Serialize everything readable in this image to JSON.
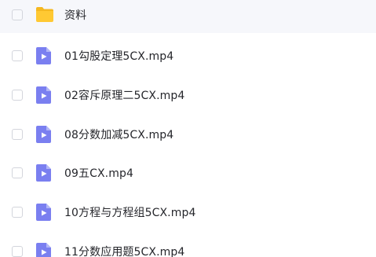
{
  "files": [
    {
      "name": "资料",
      "type": "folder",
      "icon": "folder-icon"
    },
    {
      "name": "01勾股定理5CX.mp4",
      "type": "video",
      "icon": "video-file-icon"
    },
    {
      "name": "02容斥原理二5CX.mp4",
      "type": "video",
      "icon": "video-file-icon"
    },
    {
      "name": "08分数加减5CX.mp4",
      "type": "video",
      "icon": "video-file-icon"
    },
    {
      "name": "09五CX.mp4",
      "type": "video",
      "icon": "video-file-icon"
    },
    {
      "name": "10方程与方程组5CX.mp4",
      "type": "video",
      "icon": "video-file-icon"
    },
    {
      "name": "11分数应用题5CX.mp4",
      "type": "video",
      "icon": "video-file-icon"
    }
  ],
  "colors": {
    "folder": "#ffc933",
    "folder_tab": "#f5b820",
    "video_file": "#7a7ff0",
    "video_fold": "#b2b6f7",
    "highlight_row": "#f6f7fb"
  }
}
